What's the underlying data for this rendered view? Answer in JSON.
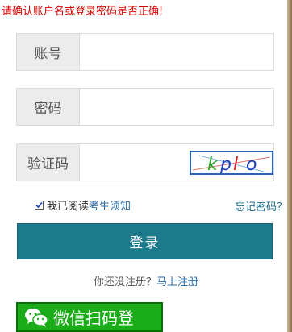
{
  "error_message": "请确认账户名或登录密码是否正确!",
  "fields": {
    "account": {
      "label": "账号",
      "value": "",
      "placeholder": ""
    },
    "password": {
      "label": "密码",
      "value": "",
      "placeholder": ""
    },
    "captcha": {
      "label": "验证码",
      "value": "",
      "placeholder": "",
      "image_text": "kpl o"
    }
  },
  "agree": {
    "checked": true,
    "text": "我已阅读",
    "link": "考生须知"
  },
  "forgot_password": "忘记密码？",
  "login_button": "登录",
  "register": {
    "text": "你还没注册？",
    "link": "马上注册"
  },
  "wechat_button": "微信扫码登",
  "colors": {
    "primary": "#1c7a8c",
    "error": "#d60000",
    "wechat": "#1aad19",
    "link": "#2a6aa3"
  }
}
